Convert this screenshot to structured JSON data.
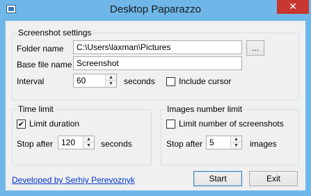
{
  "window": {
    "title": "Desktop Paparazzo",
    "close_glyph": "✕"
  },
  "screenshot_settings": {
    "legend": "Screenshot settings",
    "folder_label": "Folder name",
    "folder_value": "C:\\Users\\laxman\\Pictures",
    "browse_label": "...",
    "base_label": "Base file name",
    "base_value": "Screenshot",
    "interval_label": "Interval",
    "interval_value": "60",
    "interval_unit": "seconds",
    "include_cursor_label": "Include cursor",
    "include_cursor_checked": false
  },
  "time_limit": {
    "legend": "Time limit",
    "limit_duration_label": "Limit duration",
    "limit_duration_checked": true,
    "stop_after_label": "Stop after",
    "stop_after_value": "120",
    "unit": "seconds"
  },
  "images_limit": {
    "legend": "Images number limit",
    "limit_number_label": "Limit number of screenshots",
    "limit_number_checked": false,
    "stop_after_label": "Stop after",
    "stop_after_value": "5",
    "unit": "images"
  },
  "footer": {
    "developer_link": "Developed by Serhiy Perevoznyk",
    "start_label": "Start",
    "exit_label": "Exit"
  },
  "icons": {
    "up": "▲",
    "down": "▼",
    "check": "✔"
  },
  "colors": {
    "titlebar": "#6fb7e8",
    "close": "#c7372f",
    "link": "#0033cc"
  }
}
